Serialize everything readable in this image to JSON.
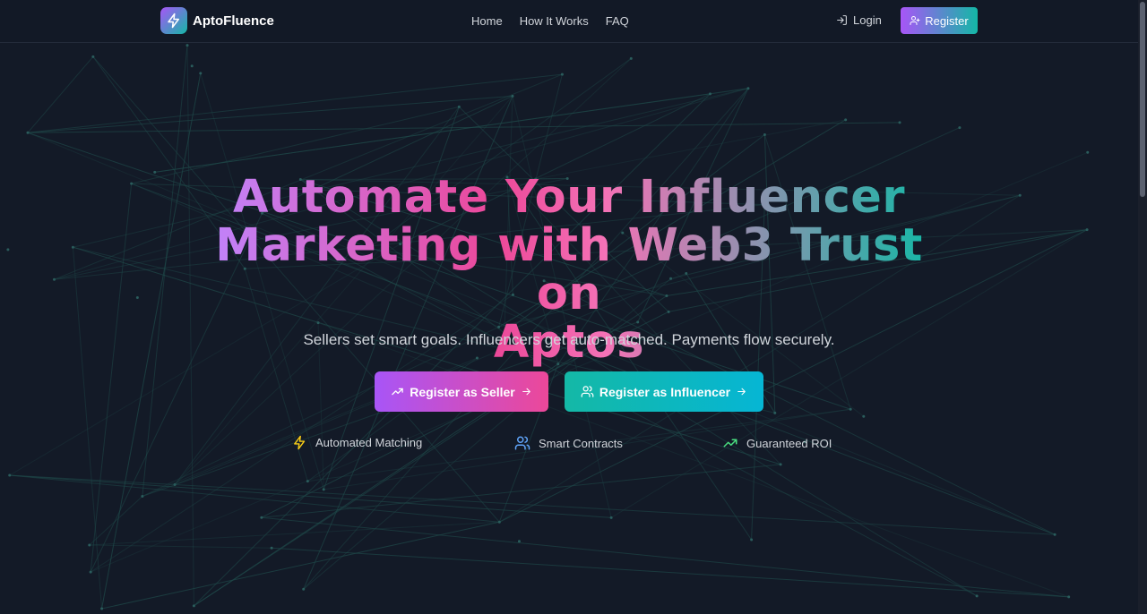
{
  "brand": {
    "name": "AptoFluence",
    "logo_icon": "bolt-icon"
  },
  "nav": {
    "links": [
      {
        "label": "Home"
      },
      {
        "label": "How It Works"
      },
      {
        "label": "FAQ"
      }
    ],
    "login_label": "Login",
    "register_label": "Register"
  },
  "hero": {
    "title_line1": "Automate Your Influencer",
    "title_line2": "Marketing with Web3 Trust on",
    "title_line3": "Aptos",
    "subtitle": "Sellers set smart goals. Influencers get auto-matched. Payments flow securely.",
    "cta_seller": "Register as Seller",
    "cta_influencer": "Register as Influencer"
  },
  "features": [
    {
      "label": "Automated Matching",
      "icon": "bolt-icon",
      "color": "#facc15"
    },
    {
      "label": "Smart Contracts",
      "icon": "users-icon",
      "color": "#60a5fa"
    },
    {
      "label": "Guaranteed ROI",
      "icon": "trending-up-icon",
      "color": "#4ade80"
    }
  ],
  "colors": {
    "background": "#131a27",
    "accent_purple": "#a855f7",
    "accent_pink": "#ec4899",
    "accent_teal": "#14b8a6",
    "network_lines": "#1f4a4a"
  }
}
